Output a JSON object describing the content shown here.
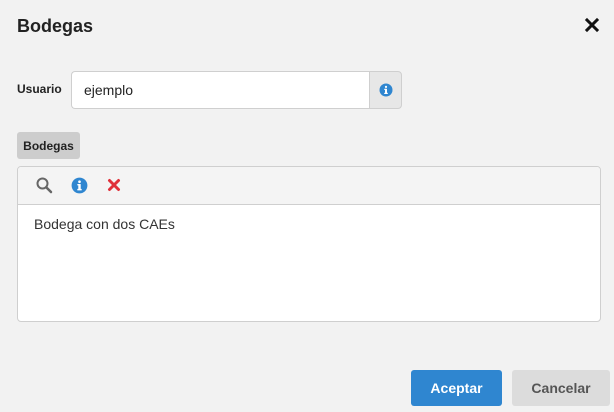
{
  "dialog": {
    "title": "Bodegas",
    "close_icon": "close-icon"
  },
  "user_field": {
    "label": "Usuario",
    "value": "ejemplo",
    "info_icon": "info-icon",
    "info_color": "#2f86d0"
  },
  "section": {
    "tab_label": "Bodegas",
    "toolbar": {
      "search_icon": "search-icon",
      "info_icon": "info-icon",
      "remove_icon": "remove-icon",
      "remove_color": "#e0303a"
    },
    "items": [
      {
        "label": "Bodega con dos CAEs"
      }
    ]
  },
  "footer": {
    "accept_label": "Aceptar",
    "cancel_label": "Cancelar",
    "accent_color": "#2f86d0"
  }
}
